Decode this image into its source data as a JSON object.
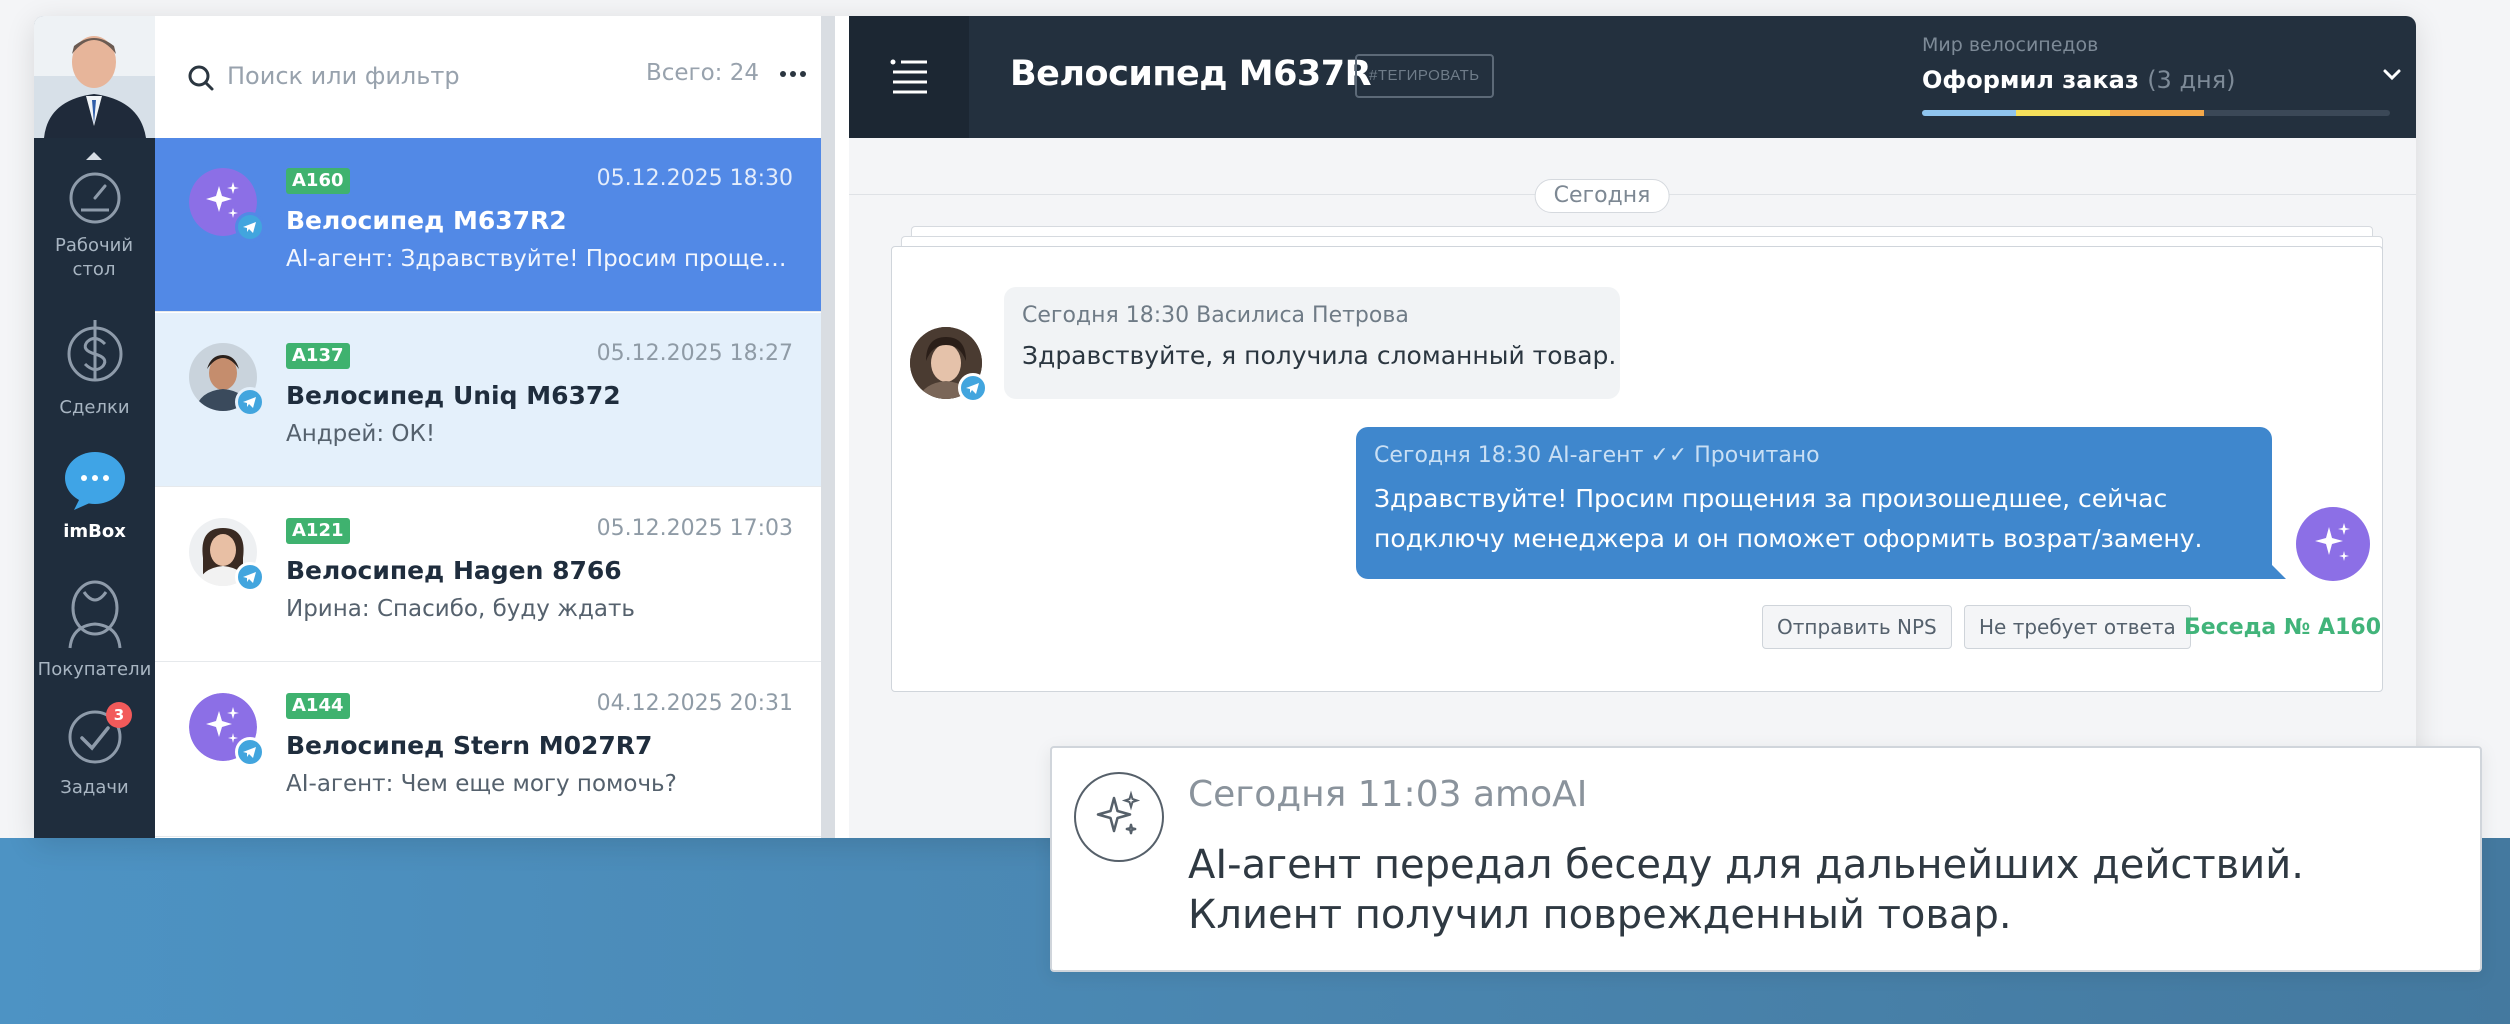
{
  "sidebar": {
    "items": [
      {
        "label": "Рабочий стол",
        "icon": "speedometer-icon"
      },
      {
        "label": "Сделки",
        "icon": "dollar-icon"
      },
      {
        "label": "imBox",
        "icon": "chat-bubble-icon",
        "active": true
      },
      {
        "label": "Покупатели",
        "icon": "customers-icon"
      },
      {
        "label": "Задачи",
        "icon": "check-circle-icon",
        "badge": "3"
      }
    ]
  },
  "list": {
    "search_placeholder": "Поиск или фильтр",
    "total_label": "Всего: 24",
    "conversations": [
      {
        "tag": "A160",
        "date": "05.12.2025 18:30",
        "title": "Велосипед M637R2",
        "preview": "AI-агент: Здравствуйте! Просим прощения за произошедшее, сейчас подключу менеджера"
      },
      {
        "tag": "A137",
        "date": "05.12.2025 18:27",
        "title": "Велосипед Uniq M6372",
        "preview": "Андрей: ОК!"
      },
      {
        "tag": "A121",
        "date": "05.12.2025 17:03",
        "title": "Велосипед Hagen 8766",
        "preview": "Ирина: Спасибо, буду ждать"
      },
      {
        "tag": "A144",
        "date": "04.12.2025 20:31",
        "title": "Велосипед Stern M027R7",
        "preview": "AI-агент: Чем еще могу помочь?"
      }
    ]
  },
  "chat": {
    "title": "Велосипед M637R",
    "tag_button": "#ТЕГИРОВАТЬ",
    "pipeline": "Мир велосипедов",
    "stage": "Оформил заказ",
    "stage_days": "(3 дня)",
    "day_label": "Сегодня",
    "incoming": {
      "meta": "Сегодня 18:30  Василиса Петрова",
      "text": "Здравствуйте, я получила сломанный товар."
    },
    "outgoing": {
      "meta": "Сегодня 18:30  AI-агент ✓✓ Прочитано",
      "text": "Здравствуйте! Просим прощения за произошедшее, сейчас подключу менеджера и он поможет оформить возрат/замену."
    },
    "actions": {
      "nps": "Отправить NPS",
      "no_reply": "Не требует ответа",
      "conversation": "Беседа № A160"
    }
  },
  "notification": {
    "meta": "Сегодня 11:03 amoAI",
    "line1": "AI-агент передал беседу для дальнейших действий.",
    "line2": "Клиент получил поврежденный товар."
  },
  "colors": {
    "active_row": "#5289e6",
    "header_dark": "#23303e",
    "bubble_out": "#3f87cd",
    "tag_green": "#3fb26f",
    "ai_purple": "#8c6fe6"
  }
}
